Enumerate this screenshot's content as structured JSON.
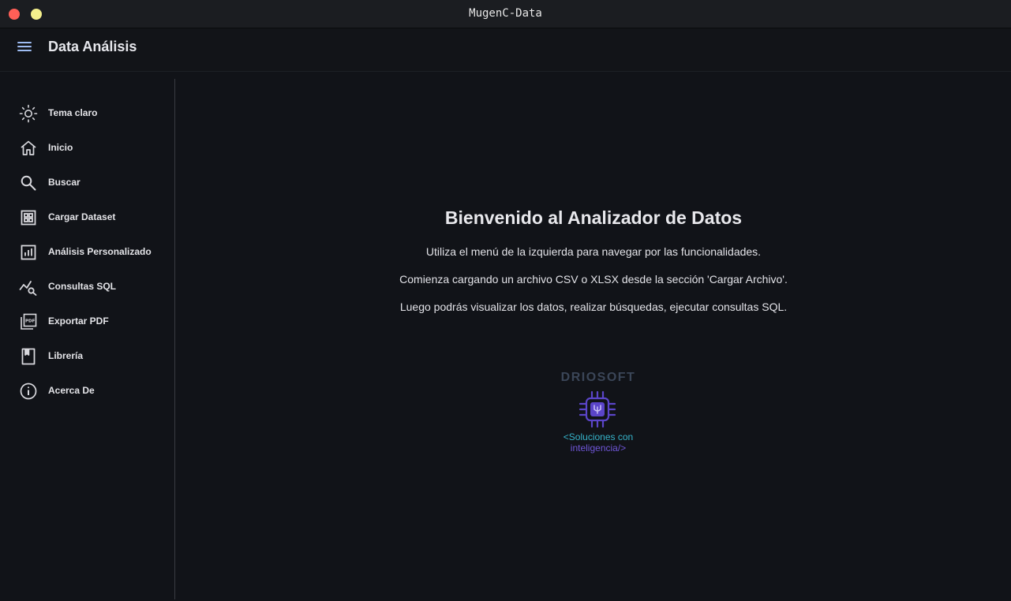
{
  "window": {
    "title": "MugenC-Data"
  },
  "appbar": {
    "title": "Data Análisis",
    "menu_icon": "hamburger-menu-icon"
  },
  "sidebar": {
    "items": [
      {
        "label": "Tema claro",
        "icon": "sun-icon"
      },
      {
        "label": "Inicio",
        "icon": "home-icon"
      },
      {
        "label": "Buscar",
        "icon": "search-icon"
      },
      {
        "label": "Cargar Dataset",
        "icon": "grid-icon"
      },
      {
        "label": "Análisis Personalizado",
        "icon": "analytics-chart-icon"
      },
      {
        "label": "Consultas SQL",
        "icon": "query-stats-icon"
      },
      {
        "label": "Exportar PDF",
        "icon": "pdf-icon"
      },
      {
        "label": "Librería",
        "icon": "book-icon"
      },
      {
        "label": "Acerca De",
        "icon": "info-icon"
      }
    ]
  },
  "main": {
    "title": "Bienvenido al Analizador de Datos",
    "lines": [
      "Utiliza el menú de la izquierda para navegar por las funcionalidades.",
      "Comienza cargando un archivo CSV o XLSX desde la sección 'Cargar Archivo'.",
      "Luego podrás visualizar los datos, realizar búsquedas, ejecutar consultas SQL."
    ]
  },
  "logo": {
    "brand": "DRIOSOFT",
    "tagline_1": "<Soluciones con",
    "tagline_2": "inteligencia/>",
    "icon": "chip-icon"
  },
  "colors": {
    "background": "#111318",
    "titlebar": "#1b1d21",
    "accent_menu": "#9ebcf2",
    "close": "#ff5f57",
    "minimize": "#f4f08c",
    "logo_cyan": "#36b3c9",
    "logo_purple": "#6f56d8"
  }
}
